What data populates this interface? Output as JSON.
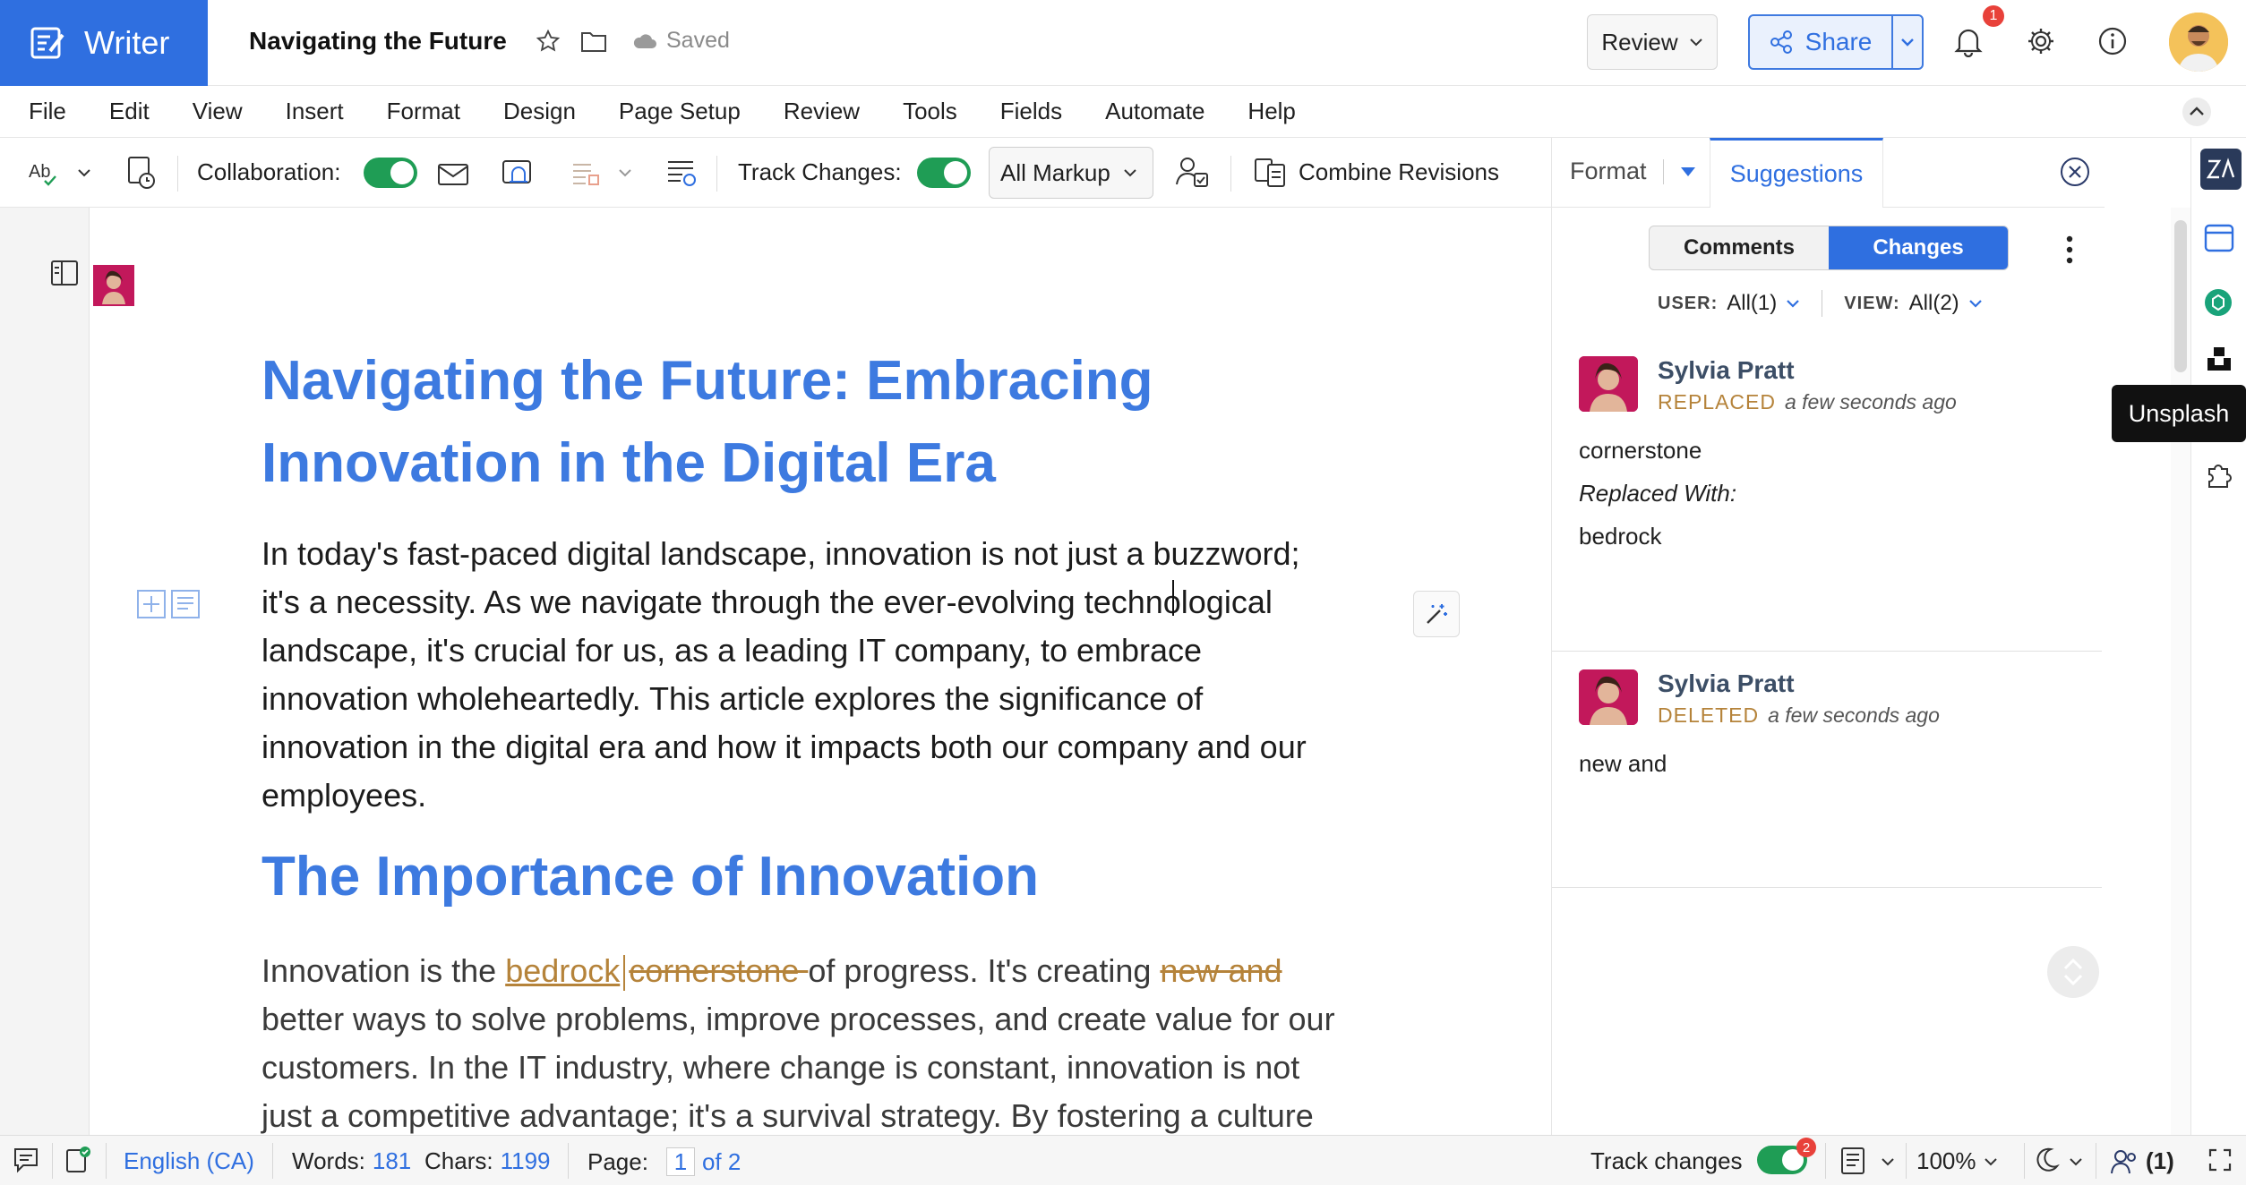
{
  "app": {
    "name": "Writer",
    "accent": "#2f6fe0"
  },
  "header": {
    "doc_title": "Navigating the Future",
    "save_status": "Saved",
    "review_label": "Review",
    "share_label": "Share",
    "notification_count": "1"
  },
  "menu": [
    "File",
    "Edit",
    "View",
    "Insert",
    "Format",
    "Design",
    "Page Setup",
    "Review",
    "Tools",
    "Fields",
    "Automate",
    "Help"
  ],
  "toolbar": {
    "collaboration_label": "Collaboration:",
    "track_changes_label": "Track Changes:",
    "markup_option": "All Markup",
    "combine_label": "Combine Revisions"
  },
  "panel": {
    "tab_format": "Format",
    "tab_suggestions": "Suggestions",
    "seg_comments": "Comments",
    "seg_changes": "Changes",
    "user_label": "USER:",
    "user_value": "All(1)",
    "view_label": "VIEW:",
    "view_value": "All(2)",
    "cards": [
      {
        "name": "Sylvia Pratt",
        "kind": "REPLACED",
        "time": "a few seconds ago",
        "original": "cornerstone",
        "replaced_with_label": "Replaced With:",
        "replacement": "bedrock"
      },
      {
        "name": "Sylvia Pratt",
        "kind": "DELETED",
        "time": "a few seconds ago",
        "text": "new and"
      }
    ]
  },
  "rail": {
    "tooltip": "Unsplash"
  },
  "document": {
    "title_line1": "Navigating the Future: Embracing",
    "title_line2": "Innovation in the Digital Era",
    "para1": [
      "In today's fast-paced digital landscape, innovation is not just a buzzword;",
      "it's a necessity. As we navigate through the ever-evolving technological",
      "landscape, it's crucial for us, as a leading IT company, to embrace",
      "innovation wholeheartedly. This article explores the significance of",
      "innovation in the digital era and how it impacts both our company and our",
      "employees."
    ],
    "heading2": "The Importance of Innovation",
    "para2_prefix": "Innovation is the ",
    "para2_inserted": "bedrock",
    "para2_deleted1": "cornerstone ",
    "para2_mid": "of progress. It's creating ",
    "para2_deleted2": "new and ",
    "para2_lines": [
      "better ways to solve problems, improve processes, and create value for our",
      "customers. In the IT industry, where change is constant, innovation is not",
      "just a competitive advantage; it's a survival strategy. By fostering a culture"
    ]
  },
  "status": {
    "language": "English (CA)",
    "words_label": "Words:",
    "words_value": "181",
    "chars_label": "Chars:",
    "chars_value": "1199",
    "page_label": "Page:",
    "page_current": "1",
    "page_total": "of 2",
    "track_changes_label": "Track changes",
    "track_badge": "2",
    "zoom": "100%",
    "collab_count": "(1)"
  }
}
